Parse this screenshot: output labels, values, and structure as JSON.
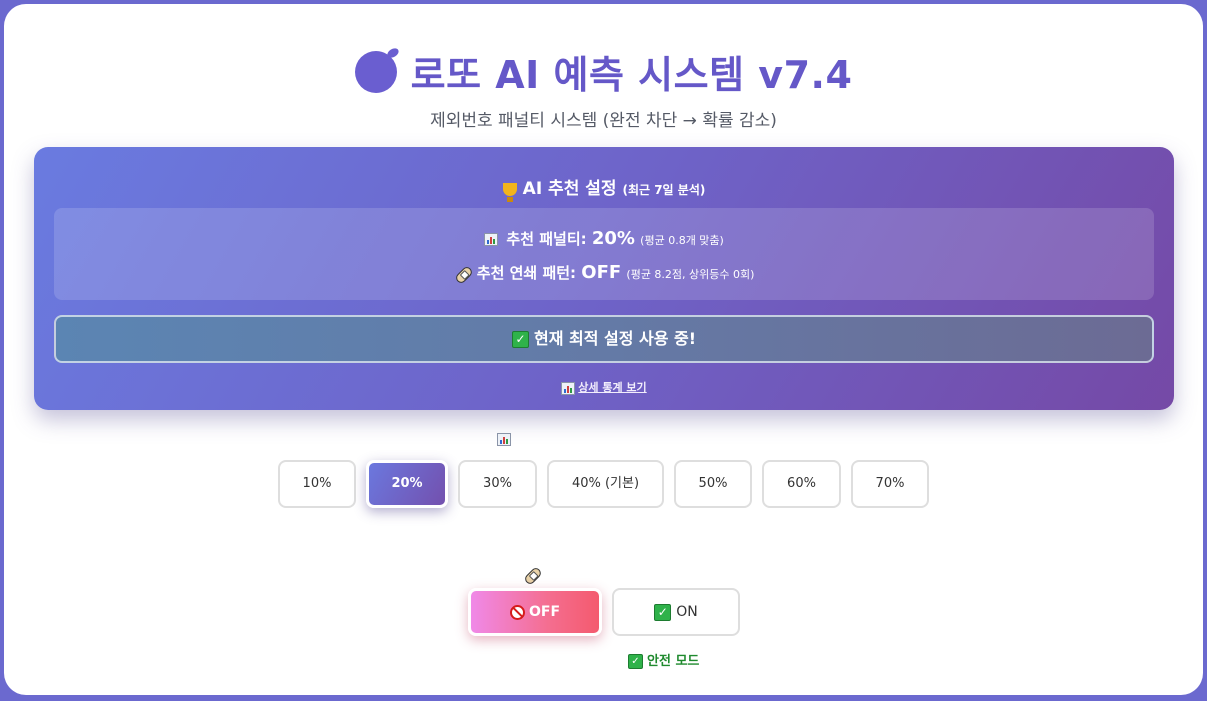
{
  "header": {
    "logo_icon": "apple-icon",
    "title": "로또 AI 예측 시스템 v7.4",
    "subtitle": "제외번호 패널티 시스템 (완전 차단 → 확률 감소)"
  },
  "recommendation": {
    "heading_icon": "trophy-icon",
    "heading": "AI 추천 설정",
    "heading_sub": "(최근 7일 분석)",
    "penalty_icon": "bar-chart-icon",
    "penalty_label": "추천 패널티: ",
    "penalty_value": "20%",
    "penalty_note": "(평균 0.8개 맞춤)",
    "pattern_icon": "bandage-icon",
    "pattern_label": "추천 연쇄 패턴: ",
    "pattern_value": "OFF",
    "pattern_note": "(평균 8.2점, 상위등수 0회)",
    "status_icon": "check-mark-icon",
    "status_text": "현재 최적 설정 사용 중!",
    "stats_link": "상세 통계 보기"
  },
  "penalty_options": {
    "icon": "bar-chart-icon",
    "selected": "20%",
    "options": [
      "10%",
      "20%",
      "30%",
      "40% (기본)",
      "50%",
      "60%",
      "70%"
    ]
  },
  "pattern_toggle": {
    "icon": "bandage-icon",
    "off_label": "OFF",
    "on_label": "ON",
    "selected": "OFF",
    "safe_mode_label": "안전 모드"
  },
  "colors": {
    "background": "#6b69cf",
    "title": "#6558c8",
    "active_gradient_start": "#6b78de",
    "active_gradient_end": "#7350ae",
    "off_gradient_start": "#f089e8",
    "off_gradient_end": "#f45a6e",
    "safe_mode": "#1f8a2e"
  }
}
